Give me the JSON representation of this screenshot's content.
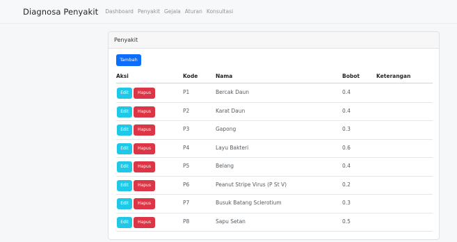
{
  "navbar": {
    "brand": "Diagnosa Penyakit",
    "links": [
      "Dashboard",
      "Penyakit",
      "Gejala",
      "Aturan",
      "Konsultasi"
    ]
  },
  "card": {
    "header": "Penyakit",
    "add_button": "Tambah"
  },
  "table": {
    "columns": [
      "Aksi",
      "Kode",
      "Nama",
      "Bobot",
      "Keterangan"
    ],
    "edit_label": "Edit",
    "delete_label": "Hapus",
    "rows": [
      {
        "kode": "P1",
        "nama": "Bercak Daun",
        "bobot": "0.4",
        "keterangan": ""
      },
      {
        "kode": "P2",
        "nama": "Karat Daun",
        "bobot": "0.4",
        "keterangan": ""
      },
      {
        "kode": "P3",
        "nama": "Gapong",
        "bobot": "0.3",
        "keterangan": ""
      },
      {
        "kode": "P4",
        "nama": "Layu Bakteri",
        "bobot": "0.6",
        "keterangan": ""
      },
      {
        "kode": "P5",
        "nama": "Belang",
        "bobot": "0.4",
        "keterangan": ""
      },
      {
        "kode": "P6",
        "nama": "Peanut Stripe Virus (P St V)",
        "bobot": "0.2",
        "keterangan": ""
      },
      {
        "kode": "P7",
        "nama": "Busuk Batang Sclerotium",
        "bobot": "0.3",
        "keterangan": ""
      },
      {
        "kode": "P8",
        "nama": "Sapu Setan",
        "bobot": "0.5",
        "keterangan": ""
      }
    ]
  },
  "colors": {
    "primary": "#0d6efd",
    "info": "#1ec8e6",
    "danger": "#dc3545"
  }
}
